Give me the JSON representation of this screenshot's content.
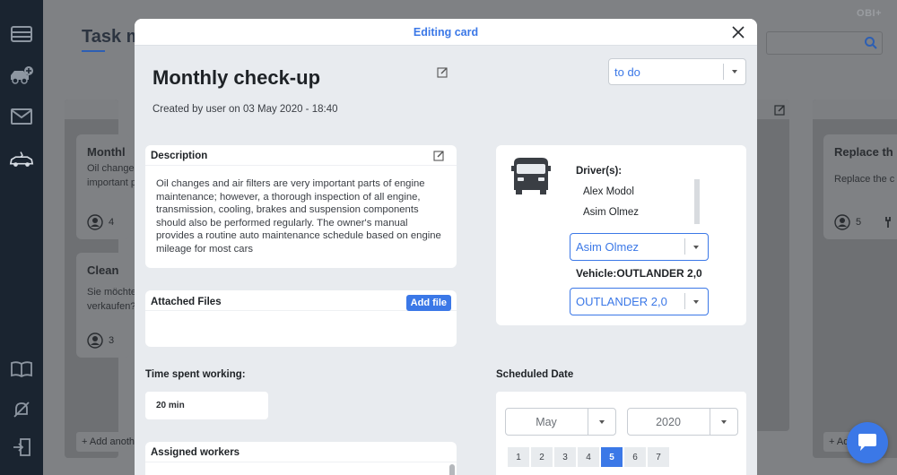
{
  "background": {
    "page_title": "Task m",
    "brand": "OBI+",
    "columns": [
      {
        "cards": [
          {
            "title": "Monthl",
            "text": [
              "Oil changes",
              "important p"
            ],
            "count": "4"
          },
          {
            "title": "Clean",
            "text": [
              "Sie möchte",
              "verkaufen?"
            ],
            "count": "3"
          }
        ],
        "add_label": "+ Add anothe"
      },
      {
        "cards": [
          {
            "title": "Replace th",
            "text": [
              "Replace the c"
            ],
            "count": "5"
          }
        ],
        "add_label": "+ Ad"
      }
    ]
  },
  "modal": {
    "title": "Editing card",
    "card_name": "Monthly check-up",
    "created": "Created by user on 03 May 2020 - 18:40",
    "status": "to do",
    "description": {
      "label": "Description",
      "text": "Oil changes and air filters are very important parts of engine maintenance; however, a thorough inspection of all engine, transmission, cooling, brakes and suspension components should also be performed regularly. The owner's manual provides a routine auto maintenance schedule based on engine mileage for most cars"
    },
    "attached_files": {
      "label": "Attached Files",
      "add_button": "Add file"
    },
    "time_spent": {
      "label": "Time spent working:",
      "value": "20 min"
    },
    "assigned_workers": {
      "label": "Assigned workers"
    },
    "drivers": {
      "label": "Driver(s):",
      "list": [
        "Alex Modol",
        "Asim Olmez"
      ],
      "selected": "Asim Olmez"
    },
    "vehicle": {
      "label": "Vehicle:OUTLANDER 2,0",
      "selected": "OUTLANDER 2,0"
    },
    "scheduled": {
      "label": "Scheduled Date",
      "month": "May",
      "year": "2020",
      "days": [
        "1",
        "2",
        "3",
        "4",
        "5",
        "6",
        "7"
      ],
      "selected_day": "5"
    }
  },
  "colors": {
    "accent": "#3b78e7",
    "rail": "#1a2430",
    "overlay": "#7f8184"
  }
}
